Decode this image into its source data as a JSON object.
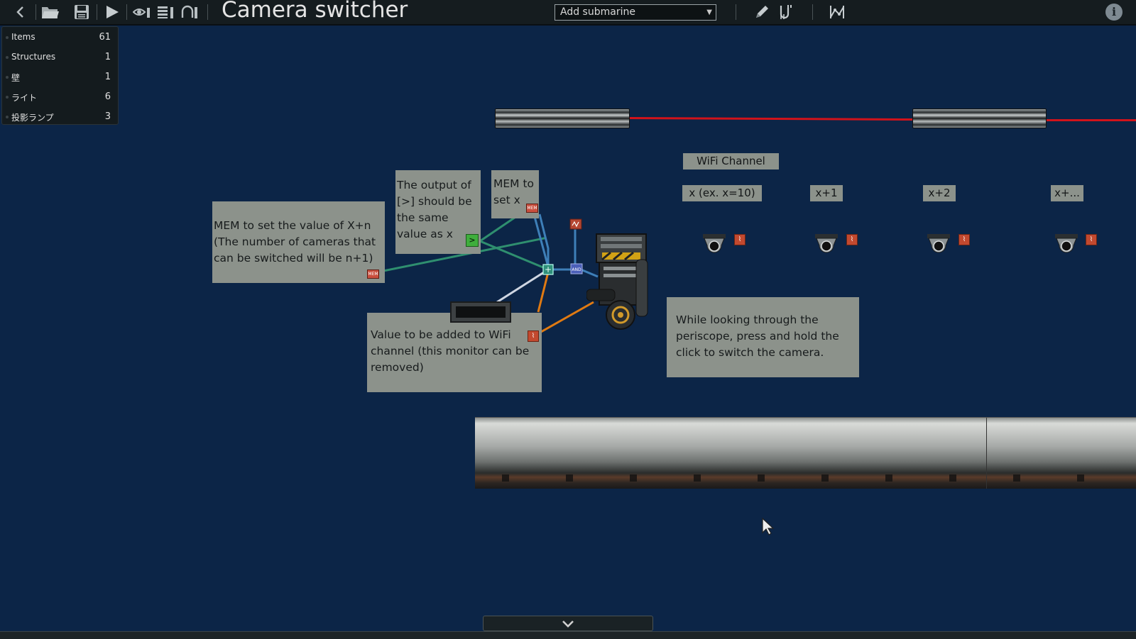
{
  "header": {
    "title": "Camera switcher",
    "dropdown_value": "Add submarine",
    "info_glyph": "i"
  },
  "layers": [
    {
      "name": "Items",
      "count": "61"
    },
    {
      "name": "Structures",
      "count": "1"
    },
    {
      "name": "壁",
      "count": "1"
    },
    {
      "name": "ライト",
      "count": "6"
    },
    {
      "name": "投影ランプ",
      "count": "3"
    }
  ],
  "notes": {
    "mem_xn": "MEM to set the value of X+n (The number of cameras that can be switched will be n+1)",
    "output": "The output of [>] should be the same value as x",
    "mem_x": "MEM to set x",
    "value_added": "Value to be added to WiFi channel (this monitor can be removed)",
    "periscope": "While looking through the periscope, press and hold the click to switch the camera."
  },
  "labels": {
    "wifi_channel": "WiFi Channel",
    "x": "x (ex. x=10)",
    "x1": "x+1",
    "x2": "x+2",
    "xn": "x+..."
  },
  "colors": {
    "background": "#0c2547",
    "note_bg": "#8c928b",
    "wire_red": "#d1131b",
    "wire_green": "#2f8f6f",
    "wire_blue": "#3e7fb8",
    "wire_orange": "#e07a12"
  }
}
